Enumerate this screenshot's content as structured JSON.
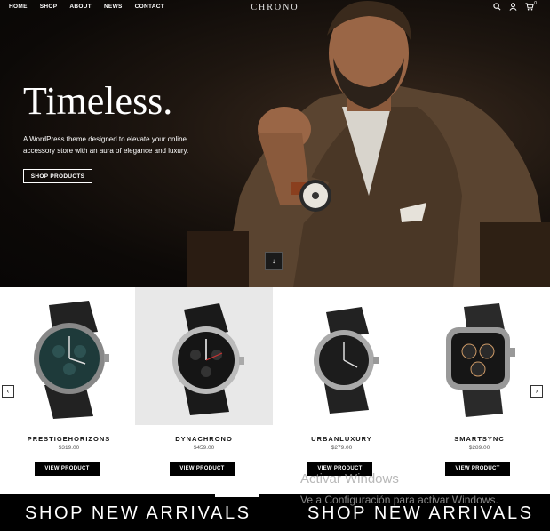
{
  "nav": {
    "items": [
      "HOME",
      "SHOP",
      "ABOUT",
      "NEWS",
      "CONTACT"
    ],
    "logo": "CHRONO",
    "icons": [
      "search-icon",
      "account-icon",
      "cart-icon"
    ],
    "cart_count": "0"
  },
  "hero": {
    "headline": "Timeless.",
    "tagline": "A WordPress theme designed to elevate your online accessory store with an aura of elegance and luxury.",
    "cta_label": "SHOP PRODUCTS",
    "scroll_icon": "arrow-down-icon"
  },
  "products": {
    "items": [
      {
        "name": "PRESTIGEHORIZONS",
        "price": "$319.00",
        "button": "VIEW PRODUCT"
      },
      {
        "name": "DYNACHRONO",
        "price": "$459.00",
        "button": "VIEW PRODUCT"
      },
      {
        "name": "URBANLUXURY",
        "price": "$279.00",
        "button": "VIEW PRODUCT"
      },
      {
        "name": "SMARTSYNC",
        "price": "$289.00",
        "button": "VIEW PRODUCT"
      }
    ],
    "prev_icon": "chevron-left-icon",
    "next_icon": "chevron-right-icon"
  },
  "banner": {
    "text_1": "SHOP NEW ARRIVALS",
    "text_2": "SHOP NEW ARRIVALS"
  },
  "watermark": {
    "title": "Activar Windows",
    "subtitle": "Ve a Configuración para activar Windows."
  },
  "colors": {
    "hero_bg": "#0c0907",
    "button_bg": "#000000",
    "text_light": "#ffffff",
    "text_dark": "#111111"
  }
}
